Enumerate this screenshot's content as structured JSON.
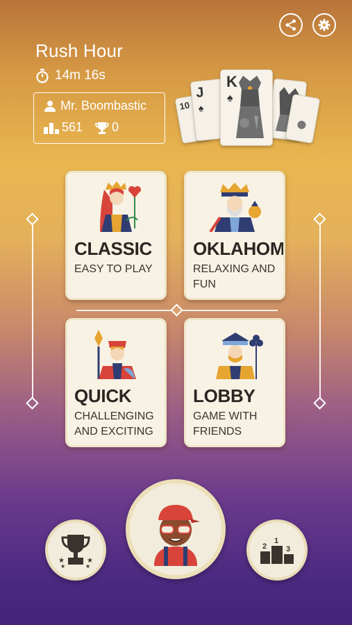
{
  "header": {
    "title": "Rush Hour",
    "timer": "14m 16s",
    "share_icon": "share-icon",
    "settings_icon": "gear-icon"
  },
  "user": {
    "name": "Mr. Boombastic",
    "score": "561",
    "trophies": "0"
  },
  "card_fan": {
    "cards": [
      "10",
      "J",
      "K"
    ]
  },
  "modes": [
    {
      "name": "CLASSIC",
      "desc": "EASY TO PLAY"
    },
    {
      "name": "OKLAHOMA",
      "desc": "RELAXING AND FUN"
    },
    {
      "name": "QUICK",
      "desc": "CHALLENGING AND EXCITING"
    },
    {
      "name": "LOBBY",
      "desc": "GAME WITH FRIENDS"
    }
  ],
  "bottom_nav": {
    "left_icon": "trophy-icon",
    "center_icon": "avatar",
    "right_icon": "podium-icon",
    "podium_labels": [
      "2",
      "1",
      "3"
    ]
  },
  "colors": {
    "accent_red": "#d8443a",
    "navy": "#2f3d72",
    "gold": "#e6a431",
    "card_bg": "#f7f2e4"
  }
}
